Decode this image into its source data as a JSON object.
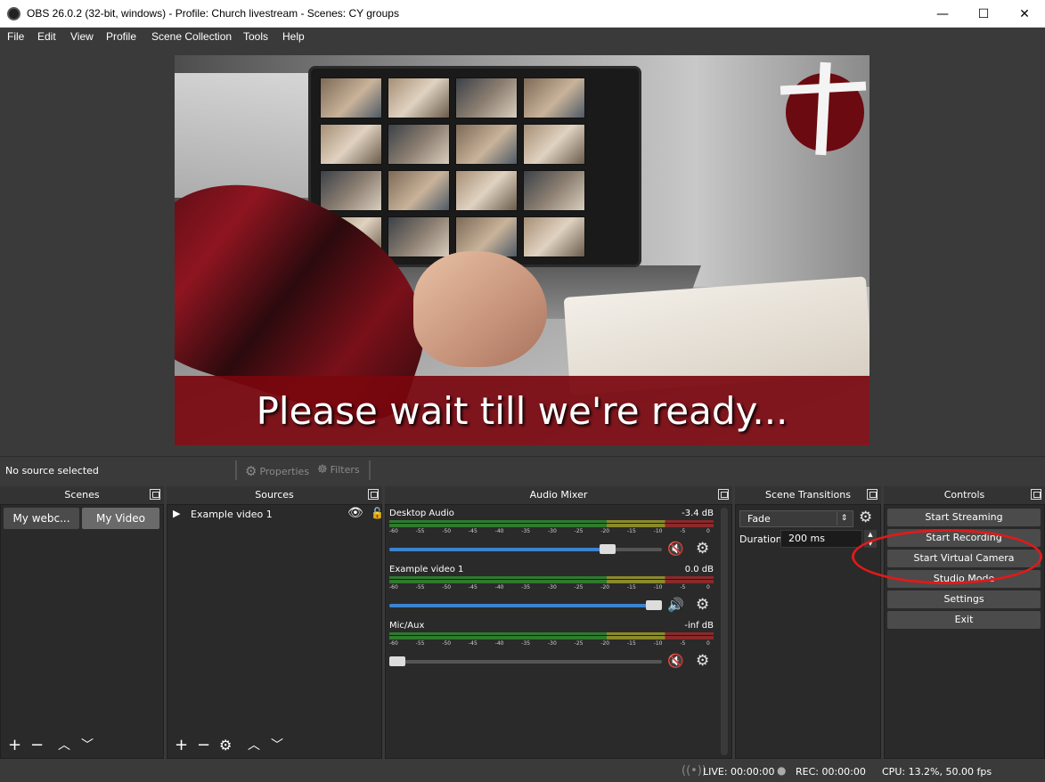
{
  "window": {
    "title": "OBS 26.0.2 (32-bit, windows) - Profile: Church livestream - Scenes: CY groups",
    "minimize": "—",
    "maximize": "☐",
    "close": "✕"
  },
  "menu": {
    "items": [
      "File",
      "Edit",
      "View",
      "Profile",
      "Scene Collection",
      "Tools",
      "Help"
    ]
  },
  "preview": {
    "banner_text": "Please wait till we're ready..."
  },
  "source_bar": {
    "no_source": "No source selected",
    "properties": "Properties",
    "filters": "Filters"
  },
  "docks": {
    "scenes": "Scenes",
    "sources": "Sources",
    "audio_mixer": "Audio Mixer",
    "scene_transitions": "Scene Transitions",
    "controls": "Controls"
  },
  "scenes": {
    "items": [
      {
        "label": "My webc...",
        "selected": false
      },
      {
        "label": "My Video",
        "selected": true
      }
    ]
  },
  "sources": {
    "items": [
      {
        "label": "Example video 1",
        "visible": true,
        "locked": false
      }
    ]
  },
  "mixer": {
    "ticks": [
      "-60",
      "-55",
      "-50",
      "-45",
      "-40",
      "-35",
      "-30",
      "-25",
      "-20",
      "-15",
      "-10",
      "-5",
      "0"
    ],
    "channels": [
      {
        "name": "Desktop Audio",
        "db": "-3.4 dB",
        "volume": 0.82,
        "muted": true
      },
      {
        "name": "Example video 1",
        "db": "0.0 dB",
        "volume": 1.0,
        "muted": false
      },
      {
        "name": "Mic/Aux",
        "db": "-inf dB",
        "volume": 0.0,
        "muted": true
      }
    ]
  },
  "transitions": {
    "selected": "Fade",
    "duration_label": "Duration",
    "duration_value": "200 ms"
  },
  "controls": {
    "buttons": [
      "Start Streaming",
      "Start Recording",
      "Start Virtual Camera",
      "Studio Mode",
      "Settings",
      "Exit"
    ]
  },
  "status": {
    "live": "LIVE: 00:00:00",
    "rec": "REC: 00:00:00",
    "cpu": "CPU: 13.2%, 50.00 fps"
  },
  "colors": {
    "accent_blue": "#3b83d1",
    "highlight_red": "#e01a1a",
    "banner_red": "#7a060e"
  }
}
